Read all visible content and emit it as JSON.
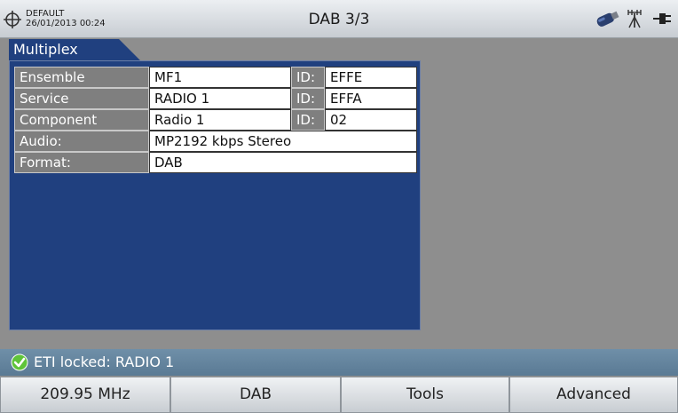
{
  "header": {
    "profile_name": "DEFAULT",
    "datetime": "26/01/2013 00:24",
    "title": "DAB 3/3",
    "icons": [
      "gps-target-icon",
      "usb-stick-icon",
      "antenna-icon",
      "power-plug-icon"
    ]
  },
  "panel": {
    "tab_label": "Multiplex",
    "rows": [
      {
        "label": "Ensemble",
        "value": "MF1",
        "id_label": "ID:",
        "id_value": "EFFE"
      },
      {
        "label": "Service",
        "value": "RADIO 1",
        "id_label": "ID:",
        "id_value": "EFFA"
      },
      {
        "label": "Component",
        "value": "Radio 1",
        "id_label": "ID:",
        "id_value": "02"
      },
      {
        "label": "Audio:",
        "value": "MP2192 kbps Stereo"
      },
      {
        "label": "Format:",
        "value": "DAB"
      }
    ]
  },
  "status": {
    "text": "ETI locked: RADIO 1",
    "icon": "check-circle-icon",
    "color": "#5fc43a"
  },
  "softkeys": [
    "209.95 MHz",
    "DAB",
    "Tools",
    "Advanced"
  ],
  "colors": {
    "panel_bg": "#20407f",
    "background": "#8e8e8e",
    "status_bar": "#6585a0"
  }
}
